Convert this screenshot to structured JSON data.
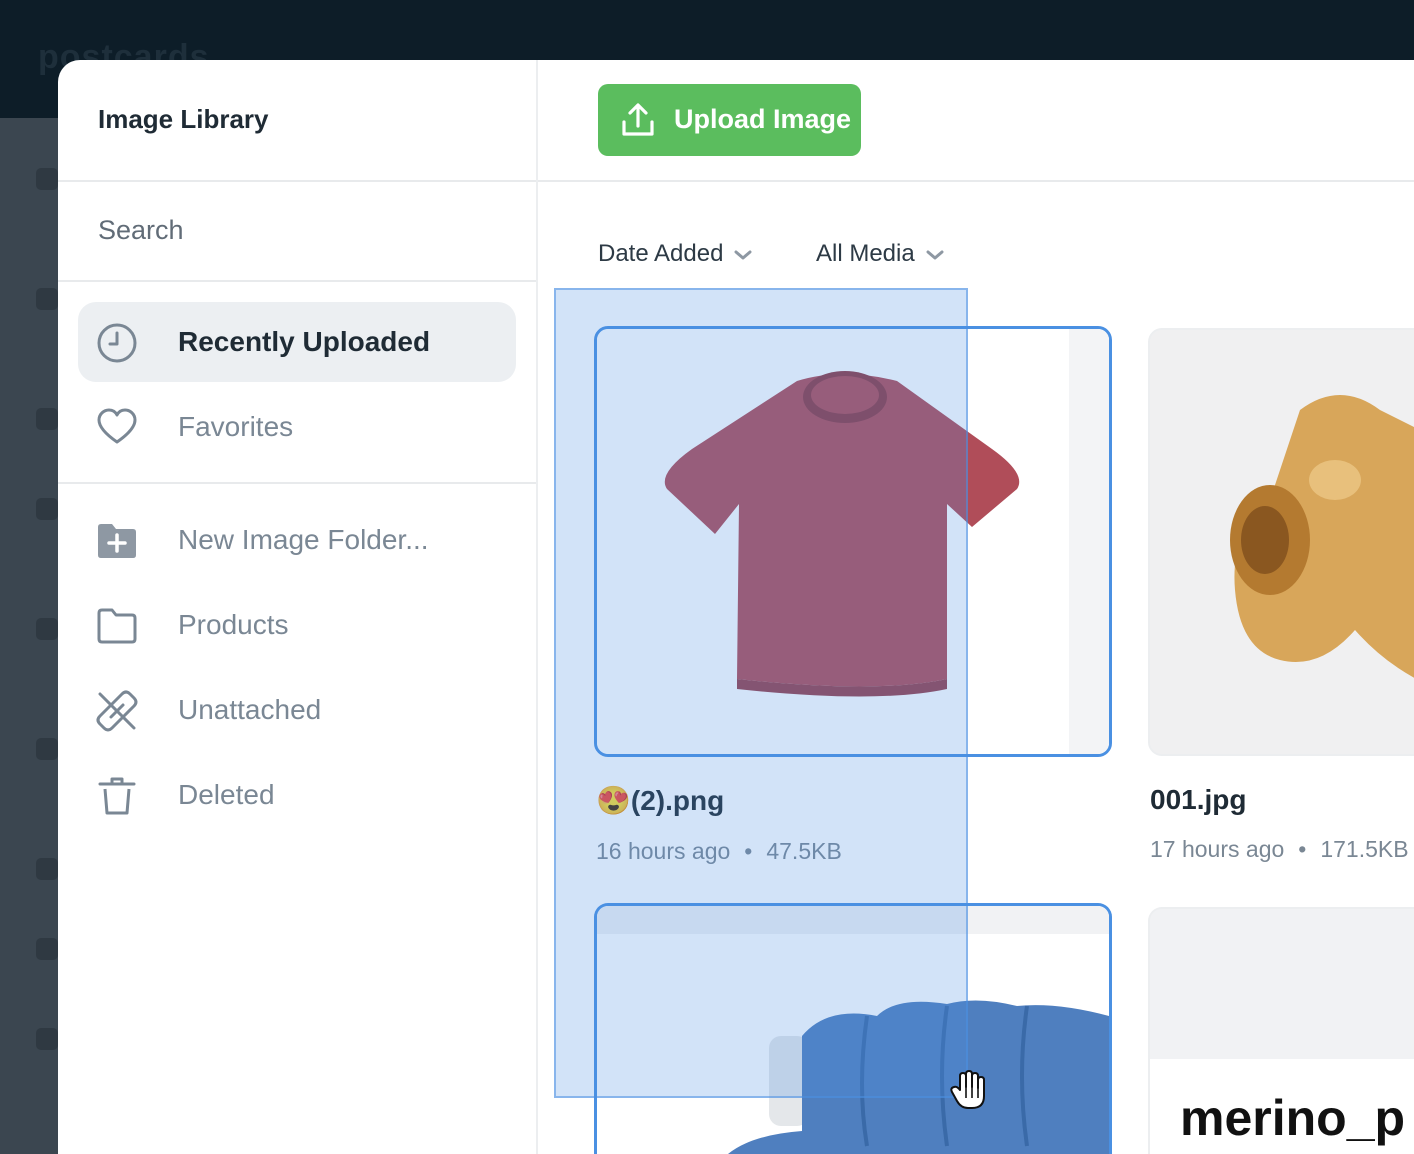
{
  "background_app": {
    "logo": "postcards"
  },
  "modal": {
    "title": "Image Library"
  },
  "search": {
    "placeholder": "Search"
  },
  "nav": {
    "primary": [
      {
        "label": "Recently Uploaded",
        "icon": "clock-icon",
        "active": true
      },
      {
        "label": "Favorites",
        "icon": "heart-icon",
        "active": false
      }
    ],
    "folders": [
      {
        "label": "New Image Folder...",
        "icon": "folder-add-icon"
      },
      {
        "label": "Products",
        "icon": "folder-icon"
      },
      {
        "label": "Unattached",
        "icon": "unlink-icon"
      },
      {
        "label": "Deleted",
        "icon": "trash-icon"
      }
    ]
  },
  "toolbar": {
    "upload_label": "Upload Image",
    "upload_icon": "upload-icon"
  },
  "filters": {
    "sort": "Date Added",
    "media": "All Media"
  },
  "images": [
    {
      "name": "😍(2).png",
      "time": "16 hours ago",
      "size": "47.5KB",
      "selected": true
    },
    {
      "name": "001.jpg",
      "time": "17 hours ago",
      "size": "171.5KB",
      "selected": false
    },
    {
      "name": "",
      "selected": true
    },
    {
      "thumb_text": "merino_p",
      "selected": false
    }
  ],
  "colors": {
    "accent_green": "#5bbd5e",
    "selection_blue": "#4a90e2",
    "active_nav_bg": "#eceff2"
  }
}
